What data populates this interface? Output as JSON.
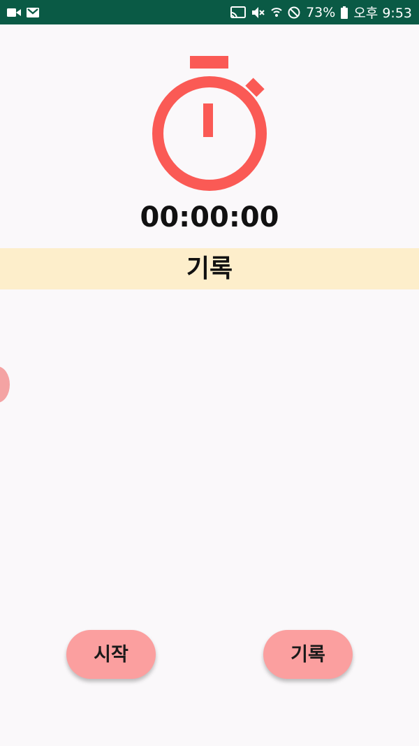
{
  "status_bar": {
    "battery": "73%",
    "time": "오후 9:53",
    "background": "#0a5a45",
    "left_icons": [
      "video-camera-icon",
      "gmail-icon"
    ],
    "right_icons": [
      "cast-icon",
      "mute-icon",
      "wifi-icon",
      "do-not-disturb-icon",
      "battery-icon"
    ]
  },
  "timer": {
    "icon": "stopwatch-icon",
    "accent": "#fa5a55",
    "display": "00:00:00"
  },
  "records": {
    "header": "기록",
    "header_background": "#fdeecb",
    "items": []
  },
  "buttons": {
    "start_label": "시작",
    "lap_label": "기록",
    "color": "#fb9f9f"
  }
}
